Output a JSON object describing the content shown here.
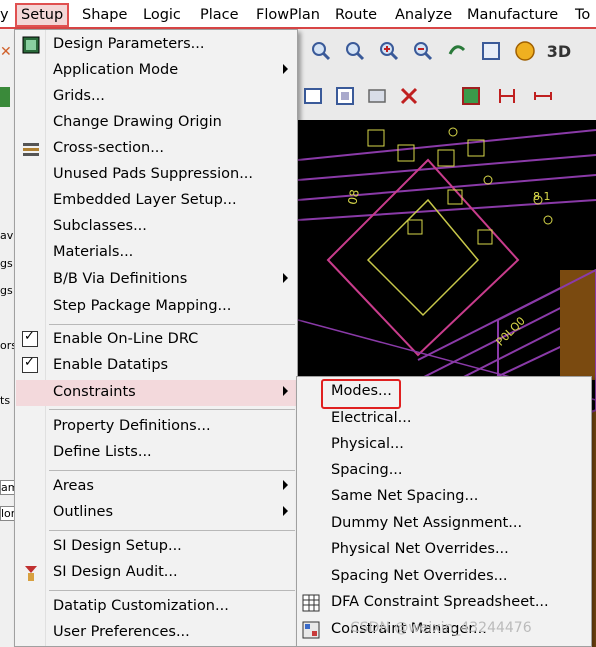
{
  "menubar": {
    "items": [
      "y",
      "Setup",
      "Shape",
      "Logic",
      "Place",
      "FlowPlan",
      "Route",
      "Analyze",
      "Manufacture",
      "To"
    ]
  },
  "left_strip": {
    "labels": [
      "avi",
      "gs",
      "gs",
      "ors",
      "ts",
      "am",
      "lor"
    ]
  },
  "setup_menu": {
    "items": [
      {
        "label": "Design Parameters...",
        "icon": "design-parameters-icon"
      },
      {
        "label": "Application Mode",
        "submenu": true
      },
      {
        "label": "Grids..."
      },
      {
        "label": "Change Drawing Origin"
      },
      {
        "label": "Cross-section...",
        "icon": "cross-section-icon"
      },
      {
        "label": "Unused Pads Suppression..."
      },
      {
        "label": "Embedded Layer Setup..."
      },
      {
        "label": "Subclasses..."
      },
      {
        "label": "Materials..."
      },
      {
        "label": "B/B Via Definitions",
        "submenu": true
      },
      {
        "label": "Step Package Mapping..."
      },
      {
        "label": "Enable On-Line DRC",
        "checked": true
      },
      {
        "label": "Enable Datatips",
        "checked": true
      },
      {
        "label": "Constraints",
        "submenu": true,
        "highlighted": true
      },
      {
        "label": "Property Definitions..."
      },
      {
        "label": "Define Lists..."
      },
      {
        "label": "Areas",
        "submenu": true
      },
      {
        "label": "Outlines",
        "submenu": true
      },
      {
        "label": "SI Design Setup..."
      },
      {
        "label": "SI Design Audit...",
        "icon": "si-audit-icon"
      },
      {
        "label": "Datatip Customization..."
      },
      {
        "label": "User Preferences..."
      }
    ]
  },
  "constraints_menu": {
    "items": [
      {
        "label": "Modes..."
      },
      {
        "label": "Electrical..."
      },
      {
        "label": "Physical..."
      },
      {
        "label": "Spacing..."
      },
      {
        "label": "Same Net Spacing..."
      },
      {
        "label": "Dummy Net Assignment..."
      },
      {
        "label": "Physical Net Overrides..."
      },
      {
        "label": "Spacing Net Overrides..."
      },
      {
        "label": "DFA Constraint Spreadsheet...",
        "icon": "spreadsheet-icon"
      },
      {
        "label": "Constraint Manager...",
        "icon": "constraint-manager-icon"
      }
    ]
  },
  "canvas": {
    "labels": [
      "08",
      "8 1",
      "P0LQ0"
    ]
  },
  "watermark": "CSDN @weixin_43244476",
  "colors": {
    "highlight": "#f3d9dc",
    "accent_red": "#e02020",
    "canvas_bg": "#000000"
  }
}
